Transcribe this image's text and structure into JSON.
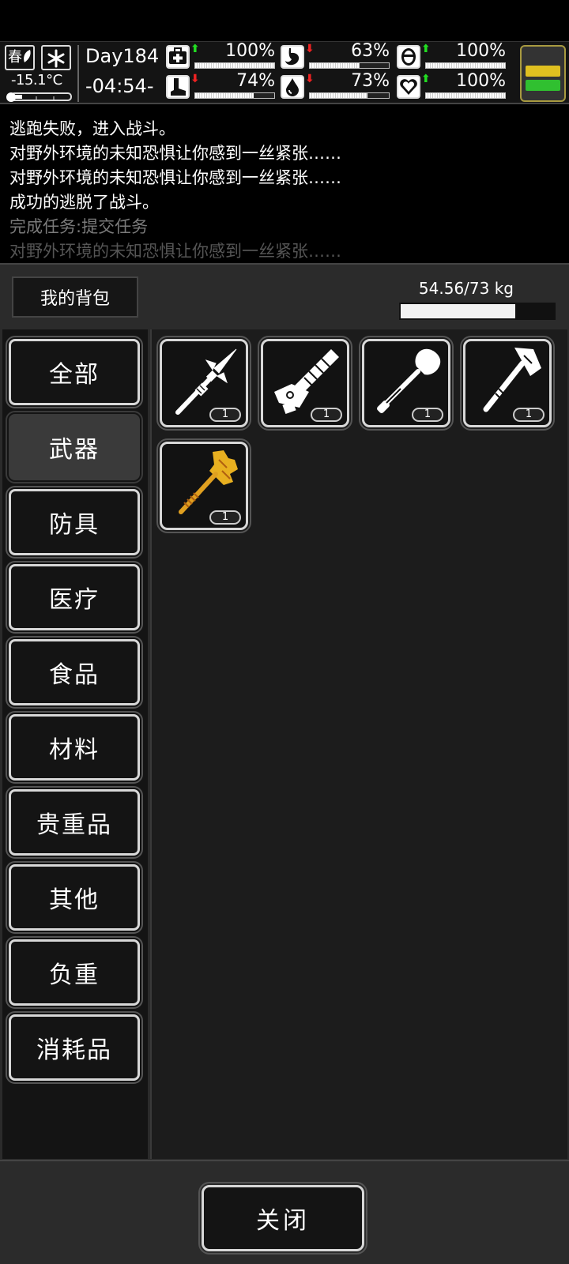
{
  "status": {
    "season": "春",
    "temperature": "-15.1°C",
    "day": "Day184",
    "time": "-04:54-",
    "stats": [
      {
        "name": "health",
        "icon": "medkit-icon",
        "trend": "up",
        "value": "100%",
        "level": 1.0
      },
      {
        "name": "hunger",
        "icon": "stomach-icon",
        "trend": "down",
        "value": "63%",
        "level": 0.63
      },
      {
        "name": "mood",
        "icon": "face-icon",
        "trend": "up",
        "value": "100%",
        "level": 1.0
      },
      {
        "name": "stamina",
        "icon": "boot-icon",
        "trend": "down",
        "value": "74%",
        "level": 0.74
      },
      {
        "name": "thirst",
        "icon": "water-drop-icon",
        "trend": "down",
        "value": "73%",
        "level": 0.73
      },
      {
        "name": "heart",
        "icon": "heart-icon",
        "trend": "up",
        "value": "100%",
        "level": 1.0
      }
    ],
    "battery_level": 0.5
  },
  "log": [
    {
      "text": "逃跑失败，进入战斗。",
      "style": "normal"
    },
    {
      "text": "对野外环境的未知恐惧让你感到一丝紧张……",
      "style": "normal"
    },
    {
      "text": "对野外环境的未知恐惧让你感到一丝紧张……",
      "style": "normal"
    },
    {
      "text": "成功的逃脱了战斗。",
      "style": "normal"
    },
    {
      "text": "完成任务:提交任务",
      "style": "dim"
    },
    {
      "text": "对野外环境的未知恐惧让你感到一丝紧张……",
      "style": "fade"
    }
  ],
  "inventory": {
    "title": "我的背包",
    "weight": "54.56/73 kg",
    "weight_fraction": 0.747,
    "categories": [
      "全部",
      "武器",
      "防具",
      "医疗",
      "食品",
      "材料",
      "贵重品",
      "其他",
      "负重",
      "消耗品"
    ],
    "selected_category": 1,
    "items": [
      {
        "name": "spear-icon",
        "qty": "1"
      },
      {
        "name": "minigun-icon",
        "qty": "1"
      },
      {
        "name": "shovel-icon",
        "qty": "1"
      },
      {
        "name": "axe-icon",
        "qty": "1"
      },
      {
        "name": "golden-hammer-icon",
        "qty": "1"
      }
    ],
    "close_label": "关闭"
  },
  "colors": {
    "arrow_up": "#22dd22",
    "arrow_down": "#ee2222",
    "battery_yellow": "#e0c020",
    "battery_green": "#30c030",
    "gold": "#e8b020"
  }
}
